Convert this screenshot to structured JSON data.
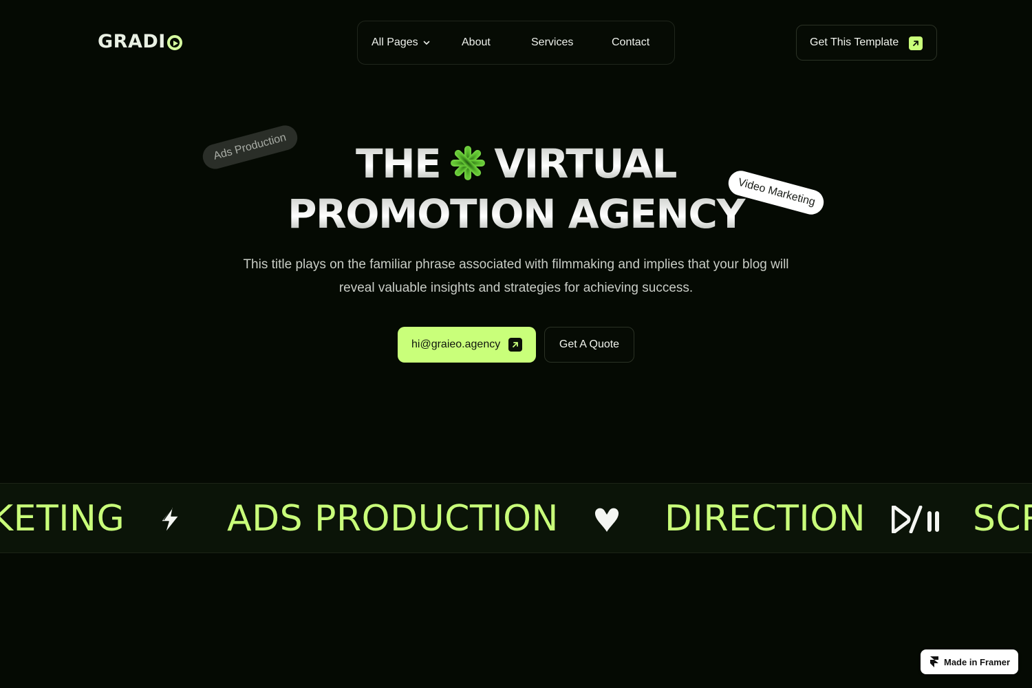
{
  "brand": {
    "name": "GRADI",
    "name_tail_icon": "play-circle-icon"
  },
  "nav": {
    "items": [
      {
        "label": "All Pages",
        "has_dropdown": true
      },
      {
        "label": "About"
      },
      {
        "label": "Services"
      },
      {
        "label": "Contact"
      }
    ]
  },
  "header_cta": {
    "label": "Get This Template",
    "icon": "arrow-up-right-icon"
  },
  "hero": {
    "title_line1_a": "THE",
    "title_line1_b": "VIRTUAL",
    "title_line2": "PROMOTION AGENCY",
    "tag_left": "Ads Production",
    "tag_right": "Video Marketing",
    "description": "This title plays on the familiar phrase associated with filmmaking and implies that your blog will reveal valuable insights and strategies for achieving success.",
    "email_button": "hi@graieo.agency",
    "quote_button": "Get A Quote"
  },
  "marquee": {
    "items": [
      "KETING",
      "ADS PRODUCTION",
      "DIRECTION",
      "SCR"
    ],
    "icons": [
      "bolt-icon",
      "heart-icon",
      "play-pause-icon"
    ]
  },
  "badge": {
    "label": "Made in Framer",
    "icon": "framer-logo-icon"
  },
  "colors": {
    "background": "#050a03",
    "accent": "#c9ff7a",
    "marquee_bg": "#0b1408",
    "text": "#e8ece6"
  }
}
